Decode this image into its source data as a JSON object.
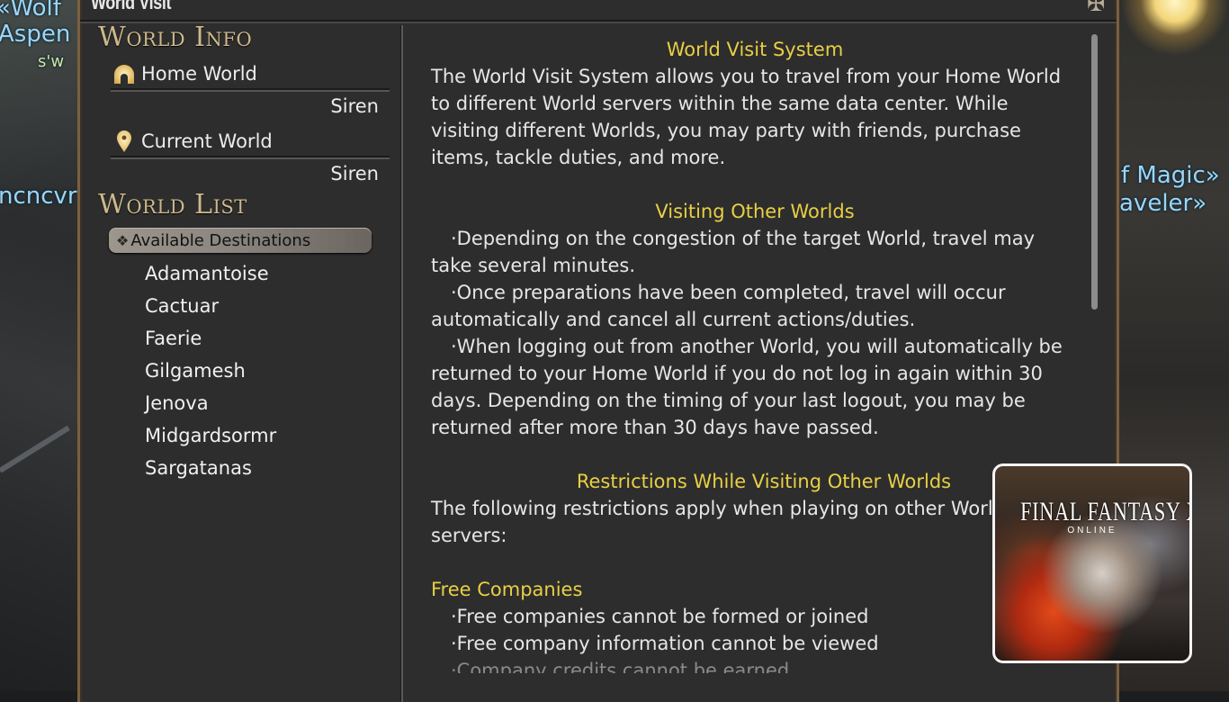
{
  "background": {
    "left_labels": [
      "«Wolf",
      "Aspen",
      "s'w",
      "ncncvr"
    ],
    "right_labels": [
      "f Magic»",
      "aveler»"
    ]
  },
  "window": {
    "title": "World Visit",
    "close_icon": "close-icon"
  },
  "world_info": {
    "heading": "World Info",
    "home_world": {
      "icon": "home-icon",
      "label": "Home World",
      "value": "Siren"
    },
    "current_world": {
      "icon": "map-pin-icon",
      "label": "Current World",
      "value": "Siren"
    }
  },
  "world_list": {
    "heading": "World List",
    "category": {
      "icon": "diamond-cluster-icon",
      "label": "Available Destinations"
    },
    "worlds": [
      "Adamantoise",
      "Cactuar",
      "Faerie",
      "Gilgamesh",
      "Jenova",
      "Midgardsormr",
      "Sargatanas"
    ]
  },
  "help": {
    "section1": {
      "heading": "World Visit System",
      "body": "The World Visit System allows you to travel from your Home World to different World servers within the same data center. While visiting different Worlds, you may party with friends, purchase items, tackle duties, and more."
    },
    "section2": {
      "heading": "Visiting Other Worlds",
      "bullets": [
        "·Depending on the congestion of the target World, travel may take several minutes.",
        "·Once preparations have been completed, travel will occur automatically and cancel all current actions/duties.",
        "·When logging out from another World, you will automatically be returned to your Home World if you do not log in again within 30 days. Depending on the timing of your last logout, you may be returned after more than 30 days have passed."
      ]
    },
    "section3": {
      "heading": "Restrictions While Visiting Other Worlds",
      "body": "The following restrictions apply when playing on other World servers:"
    },
    "section4": {
      "heading": "Free Companies",
      "bullets": [
        "·Free companies cannot be formed or joined",
        "·Free company information cannot be viewed",
        "·Company credits cannot be earned"
      ]
    }
  },
  "overlay": {
    "title": "FINAL FANTASY XIV",
    "subtitle": "ONLINE"
  },
  "colors": {
    "heading_gold": "#cdb88c",
    "section_yellow": "#e8cf44",
    "frame_bronze": "#7a6040",
    "panel_bg": "#2d2d2d",
    "nameplate_blue": "#9cd5f5"
  }
}
